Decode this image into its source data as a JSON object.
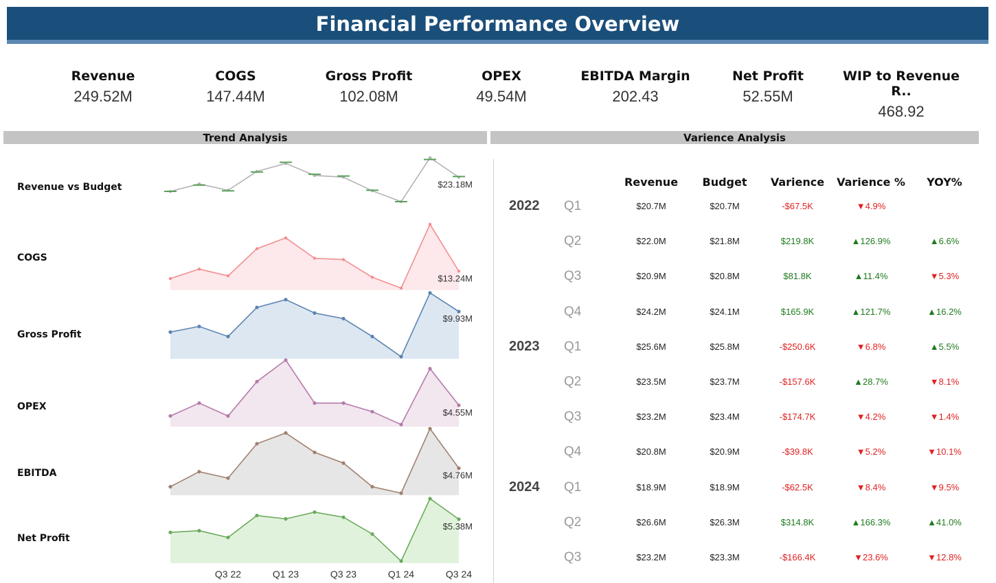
{
  "title": "Financial Performance Overview",
  "kpis": [
    {
      "label": "Revenue",
      "value": "249.52M"
    },
    {
      "label": "COGS",
      "value": "147.44M"
    },
    {
      "label": "Gross Profit",
      "value": "102.08M"
    },
    {
      "label": "OPEX",
      "value": "49.54M"
    },
    {
      "label": "EBITDA Margin",
      "value": "202.43"
    },
    {
      "label": "Net Profit",
      "value": "52.55M"
    },
    {
      "label": "WIP to Revenue R..",
      "value": "468.92"
    }
  ],
  "sections": {
    "trend": "Trend Analysis",
    "variance": "Varience Analysis"
  },
  "colors": {
    "title_bar": "#1b4f7b",
    "positive": "#1e7a1e",
    "negative": "#e02020"
  },
  "chart_data": {
    "type": "line",
    "x": [
      "Q1 22",
      "Q2 22",
      "Q3 22",
      "Q4 22",
      "Q1 23",
      "Q2 23",
      "Q3 23",
      "Q4 23",
      "Q1 24",
      "Q2 24",
      "Q3 24"
    ],
    "x_tick_labels": [
      "Q3 22",
      "Q1 23",
      "Q3 23",
      "Q1 24",
      "Q3 24"
    ],
    "series": [
      {
        "name": "Revenue vs Budget",
        "line_color": "#b3b3b3",
        "budget_color": "#5aa05a",
        "values": [
          20.7,
          22.0,
          20.9,
          24.2,
          25.6,
          23.5,
          23.2,
          20.8,
          18.9,
          26.6,
          23.18
        ],
        "budget": [
          20.7,
          21.8,
          20.8,
          24.1,
          25.8,
          23.7,
          23.4,
          20.9,
          18.9,
          26.3,
          23.3
        ],
        "end_label": "$23.18M",
        "markers": false
      },
      {
        "name": "COGS",
        "line_color": "#f28e8e",
        "fill_color": "#fde8ec",
        "values": [
          12.7,
          13.4,
          12.9,
          14.9,
          15.7,
          14.2,
          14.1,
          12.8,
          12.0,
          16.7,
          13.24
        ],
        "end_label": "$13.24M",
        "markers": false
      },
      {
        "name": "Gross Profit",
        "line_color": "#5b84b1",
        "fill_color": "#dde7f1",
        "values": [
          8.1,
          8.6,
          7.7,
          10.3,
          11.0,
          9.8,
          9.3,
          7.7,
          5.9,
          11.6,
          9.93
        ],
        "end_label": "$9.93M",
        "markers": true
      },
      {
        "name": "OPEX",
        "line_color": "#b57aaa",
        "fill_color": "#f2e6ef",
        "values": [
          4.3,
          4.6,
          4.3,
          5.1,
          5.6,
          4.6,
          4.6,
          4.4,
          4.1,
          5.4,
          4.55
        ],
        "end_label": "$4.55M",
        "markers": true
      },
      {
        "name": "EBITDA",
        "line_color": "#a08070",
        "fill_color": "#e6e6e6",
        "values": [
          3.9,
          4.6,
          4.3,
          5.9,
          6.4,
          5.5,
          5.0,
          3.9,
          3.6,
          6.6,
          4.76
        ],
        "end_label": "$4.76M",
        "markers": true
      },
      {
        "name": "Net Profit",
        "line_color": "#6aaa5c",
        "fill_color": "#e1f2dc",
        "values": [
          4.6,
          4.7,
          4.3,
          5.6,
          5.4,
          5.8,
          5.5,
          4.5,
          2.9,
          6.6,
          5.38
        ],
        "end_label": "$5.38M",
        "markers": true
      }
    ]
  },
  "variance": {
    "headers": [
      "Revenue",
      "Budget",
      "Varience",
      "Varience %",
      "YOY%"
    ],
    "rows": [
      {
        "year": "2022",
        "q": "Q1",
        "rev": "$20.7M",
        "bud": "$20.7M",
        "var": "-$67.5K",
        "var_s": "neg",
        "pct": "▼4.9%",
        "pct_s": "neg",
        "yoy": "",
        "yoy_s": "neg"
      },
      {
        "year": "",
        "q": "Q2",
        "rev": "$22.0M",
        "bud": "$21.8M",
        "var": "$219.8K",
        "var_s": "pos",
        "pct": "▲126.9%",
        "pct_s": "pos",
        "yoy": "▲6.6%",
        "yoy_s": "pos"
      },
      {
        "year": "",
        "q": "Q3",
        "rev": "$20.9M",
        "bud": "$20.8M",
        "var": "$81.8K",
        "var_s": "pos",
        "pct": "▲11.4%",
        "pct_s": "pos",
        "yoy": "▼5.3%",
        "yoy_s": "neg"
      },
      {
        "year": "",
        "q": "Q4",
        "rev": "$24.2M",
        "bud": "$24.1M",
        "var": "$165.9K",
        "var_s": "pos",
        "pct": "▲121.7%",
        "pct_s": "pos",
        "yoy": "▲16.2%",
        "yoy_s": "pos"
      },
      {
        "year": "2023",
        "q": "Q1",
        "rev": "$25.6M",
        "bud": "$25.8M",
        "var": "-$250.6K",
        "var_s": "neg",
        "pct": "▼6.8%",
        "pct_s": "neg",
        "yoy": "▲5.5%",
        "yoy_s": "pos"
      },
      {
        "year": "",
        "q": "Q2",
        "rev": "$23.5M",
        "bud": "$23.7M",
        "var": "-$157.6K",
        "var_s": "neg",
        "pct": "▲28.7%",
        "pct_s": "pos",
        "yoy": "▼8.1%",
        "yoy_s": "neg"
      },
      {
        "year": "",
        "q": "Q3",
        "rev": "$23.2M",
        "bud": "$23.4M",
        "var": "-$174.7K",
        "var_s": "neg",
        "pct": "▼4.2%",
        "pct_s": "neg",
        "yoy": "▼1.4%",
        "yoy_s": "neg"
      },
      {
        "year": "",
        "q": "Q4",
        "rev": "$20.8M",
        "bud": "$20.9M",
        "var": "-$39.8K",
        "var_s": "neg",
        "pct": "▼5.2%",
        "pct_s": "neg",
        "yoy": "▼10.1%",
        "yoy_s": "neg"
      },
      {
        "year": "2024",
        "q": "Q1",
        "rev": "$18.9M",
        "bud": "$18.9M",
        "var": "-$62.5K",
        "var_s": "neg",
        "pct": "▼8.4%",
        "pct_s": "neg",
        "yoy": "▼9.5%",
        "yoy_s": "neg"
      },
      {
        "year": "",
        "q": "Q2",
        "rev": "$26.6M",
        "bud": "$26.3M",
        "var": "$314.8K",
        "var_s": "pos",
        "pct": "▲166.3%",
        "pct_s": "pos",
        "yoy": "▲41.0%",
        "yoy_s": "pos"
      },
      {
        "year": "",
        "q": "Q3",
        "rev": "$23.2M",
        "bud": "$23.3M",
        "var": "-$166.4K",
        "var_s": "neg",
        "pct": "▼23.6%",
        "pct_s": "neg",
        "yoy": "▼12.8%",
        "yoy_s": "neg"
      }
    ]
  }
}
